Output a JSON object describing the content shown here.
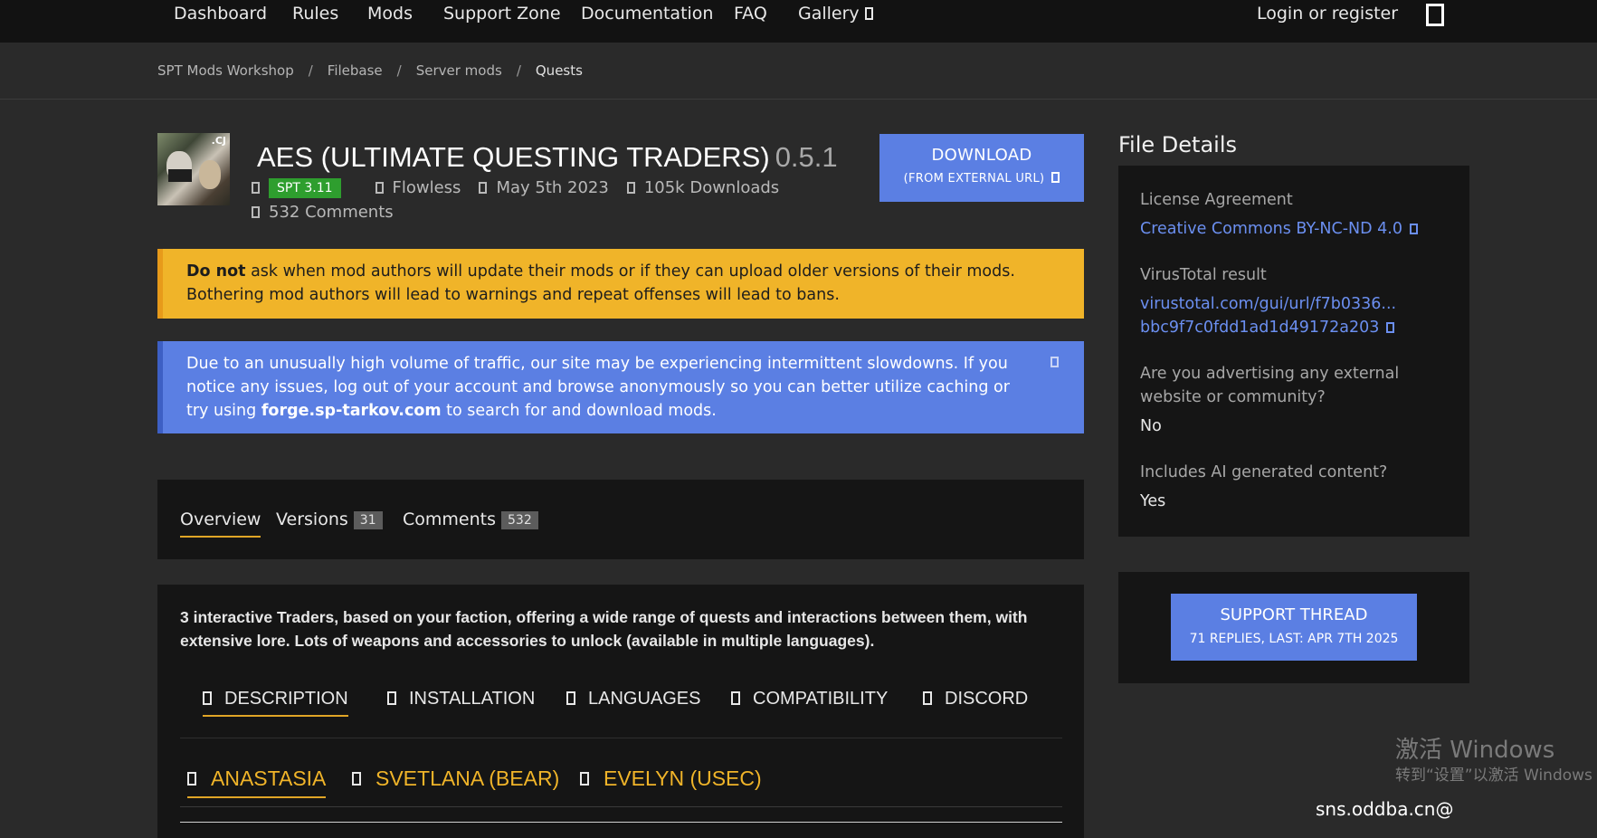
{
  "nav": {
    "items": [
      "Dashboard",
      "Rules",
      "Mods",
      "Support Zone",
      "Documentation",
      "FAQ",
      "Gallery"
    ],
    "login": "Login or register",
    "user_icon": "user-square-icon"
  },
  "breadcrumb": {
    "items": [
      "SPT Mods Workshop",
      "Filebase",
      "Server mods",
      "Quests"
    ],
    "separator": "/"
  },
  "mod": {
    "title": "AES (ULTIMATE QUESTING TRADERS)",
    "version": "0.5.1",
    "spt_badge": "SPT 3.11",
    "author": "Flowless",
    "date": "May 5th 2023",
    "downloads": "105k Downloads",
    "comments": "532 Comments",
    "avatar_tag": ".CJ"
  },
  "download": {
    "label": "DOWNLOAD",
    "sublabel": "(FROM EXTERNAL URL)"
  },
  "alerts": {
    "warning_bold": "Do not",
    "warning_text": " ask when mod authors will update their mods or if they can upload older versions of their mods. Bothering mod authors will lead to warnings and repeat offenses will lead to bans.",
    "info_text": "Due to an unusually high volume of traffic, our site may be experiencing intermittent slowdowns. If you notice any issues, log out of your account and browse anonymously so you can better utilize caching or try using ",
    "info_bold": "forge.sp-tarkov.com",
    "info_tail": " to search for and download mods."
  },
  "tabs": [
    {
      "label": "Overview",
      "count": ""
    },
    {
      "label": "Versions",
      "count": "31"
    },
    {
      "label": "Comments",
      "count": "532"
    }
  ],
  "content": {
    "summary": "3 interactive Traders, based on your faction, offering a wide range of quests and interactions between them, with extensive lore. Lots of weapons and accessories to unlock (available in multiple languages).",
    "subtabs": [
      "DESCRIPTION",
      "INSTALLATION",
      "LANGUAGES",
      "COMPATIBILITY",
      "DISCORD"
    ],
    "npc_tabs": [
      "ANASTASIA",
      "SVETLANA (BEAR)",
      "EVELYN (USEC)"
    ]
  },
  "sidebar": {
    "title": "File Details",
    "license_label": "License Agreement",
    "license_value": "Creative Commons BY-NC-ND 4.0",
    "virustotal_label": "VirusTotal result",
    "virustotal_line1": "virustotal.com/gui/url/f7b0336...",
    "virustotal_line2": "bbc9f7c0fdd1ad1d49172a203",
    "advertising_label": "Are you advertising any external website or community?",
    "advertising_value": "No",
    "ai_label": "Includes AI generated content?",
    "ai_value": "Yes"
  },
  "support": {
    "label": "SUPPORT THREAD",
    "sublabel": "71 REPLIES, LAST: APR 7TH 2025"
  },
  "watermark": {
    "windows_line1": "激活 Windows",
    "windows_line2": "转到“设置”以激活 Windows",
    "site": "sns.oddba.cn@"
  },
  "colors": {
    "accent_blue": "#5b7fe3",
    "warning_yellow": "#f0b429",
    "tab_underline": "#e0a526",
    "badge_green": "#2e9e2e"
  }
}
